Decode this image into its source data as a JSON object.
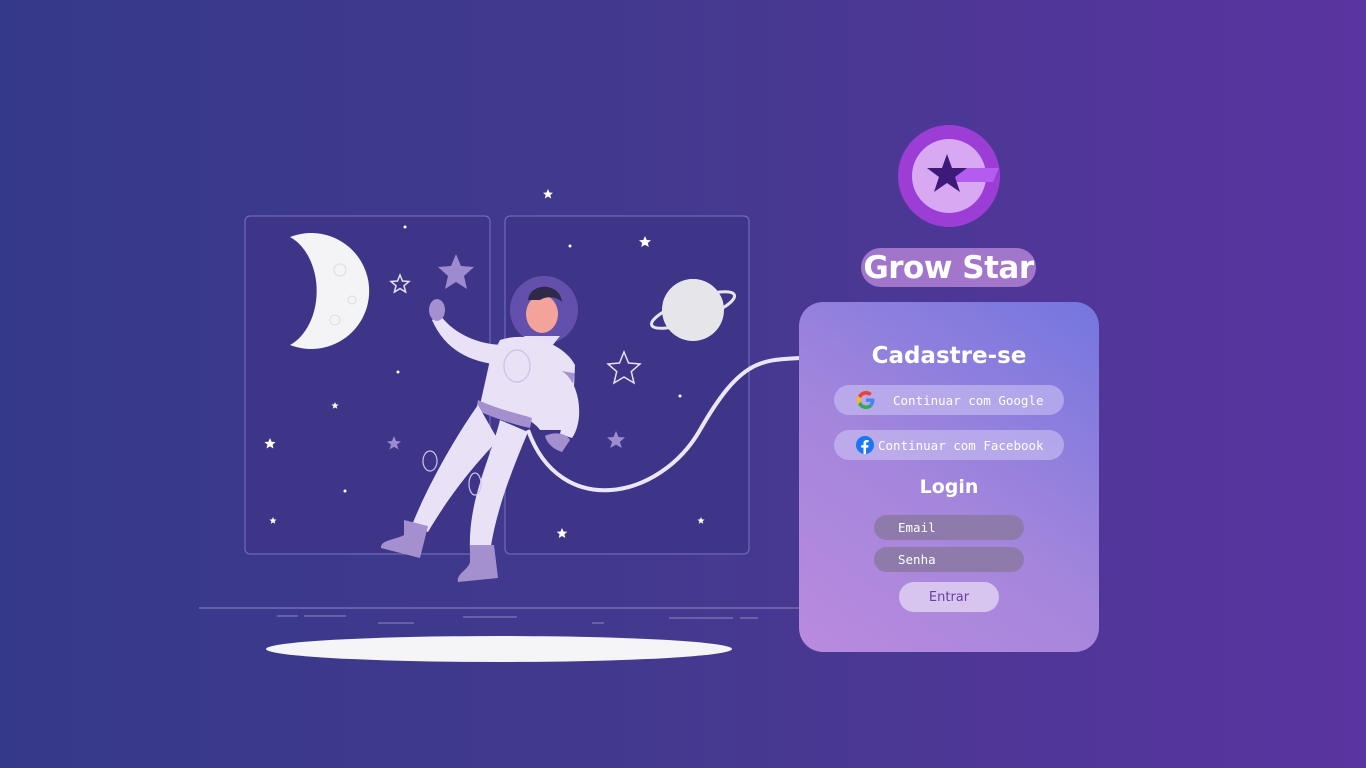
{
  "brand": {
    "name": "Grow Star",
    "logo_icon": "star-g-logo-icon"
  },
  "signup": {
    "title": "Cadastre-se",
    "google_label": "Continuar com Google",
    "google_icon": "google-icon",
    "facebook_label": "Continuar com Facebook",
    "facebook_icon": "facebook-icon"
  },
  "login": {
    "title": "Login",
    "email_placeholder": "Email",
    "password_placeholder": "Senha",
    "submit_label": "Entrar"
  },
  "colors": {
    "background_start": "#35398a",
    "background_end": "#5a34a0",
    "card_start": "#b98ade",
    "card_end": "#7476df",
    "accent": "#6b3fa0"
  },
  "illustration": {
    "subject": "astronaut-illustration",
    "elements": [
      "moon-icon",
      "planet-icon",
      "star-icon"
    ]
  }
}
